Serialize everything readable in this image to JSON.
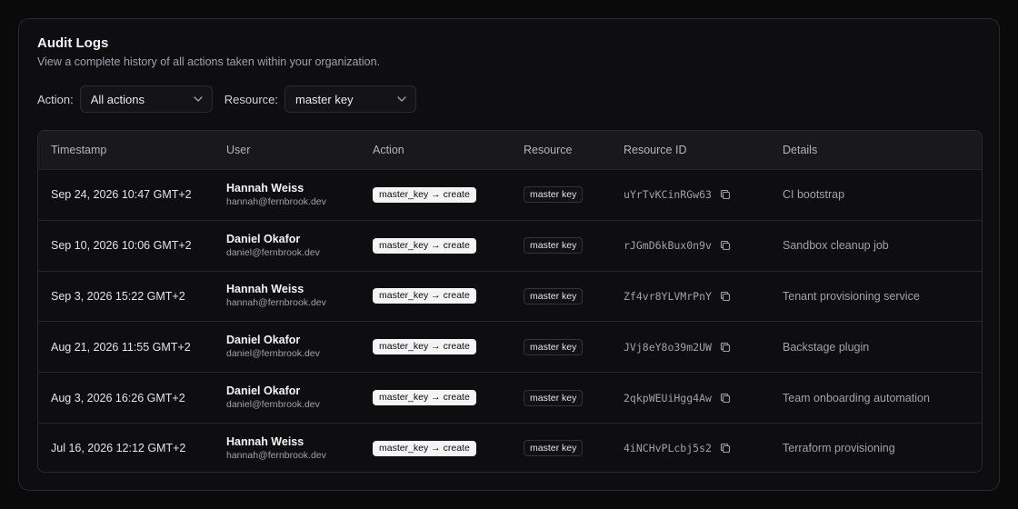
{
  "header": {
    "title": "Audit Logs",
    "subtitle": "View a complete history of all actions taken within your organization."
  },
  "filters": {
    "action_label": "Action:",
    "action_value": "All actions",
    "resource_label": "Resource:",
    "resource_value": "master key"
  },
  "table": {
    "columns": [
      "Timestamp",
      "User",
      "Action",
      "Resource",
      "Resource ID",
      "Details"
    ],
    "rows": [
      {
        "timestamp": "Sep 24, 2026 10:47 GMT+2",
        "user_name": "Hannah Weiss",
        "user_email": "hannah@fernbrook.dev",
        "action": "master_key → create",
        "resource": "master key",
        "resource_id": "uYrTvKCinRGw63",
        "details": "CI bootstrap"
      },
      {
        "timestamp": "Sep 10, 2026 10:06 GMT+2",
        "user_name": "Daniel Okafor",
        "user_email": "daniel@fernbrook.dev",
        "action": "master_key → create",
        "resource": "master key",
        "resource_id": "rJGmD6kBux0n9v",
        "details": "Sandbox cleanup job"
      },
      {
        "timestamp": "Sep 3, 2026 15:22 GMT+2",
        "user_name": "Hannah Weiss",
        "user_email": "hannah@fernbrook.dev",
        "action": "master_key → create",
        "resource": "master key",
        "resource_id": "Zf4vr8YLVMrPnY",
        "details": "Tenant provisioning service"
      },
      {
        "timestamp": "Aug 21, 2026 11:55 GMT+2",
        "user_name": "Daniel Okafor",
        "user_email": "daniel@fernbrook.dev",
        "action": "master_key → create",
        "resource": "master key",
        "resource_id": "JVj8eY8o39m2UW",
        "details": "Backstage plugin"
      },
      {
        "timestamp": "Aug 3, 2026 16:26 GMT+2",
        "user_name": "Daniel Okafor",
        "user_email": "daniel@fernbrook.dev",
        "action": "master_key → create",
        "resource": "master key",
        "resource_id": "2qkpWEUiHgg4Aw",
        "details": "Team onboarding automation"
      },
      {
        "timestamp": "Jul 16, 2026 12:12 GMT+2",
        "user_name": "Hannah Weiss",
        "user_email": "hannah@fernbrook.dev",
        "action": "master_key → create",
        "resource": "master key",
        "resource_id": "4iNCHvPLcbj5s2",
        "details": "Terraform provisioning"
      }
    ]
  },
  "icons": {
    "select_chevron": "chevron-down-icon",
    "copy": "copy-icon"
  }
}
